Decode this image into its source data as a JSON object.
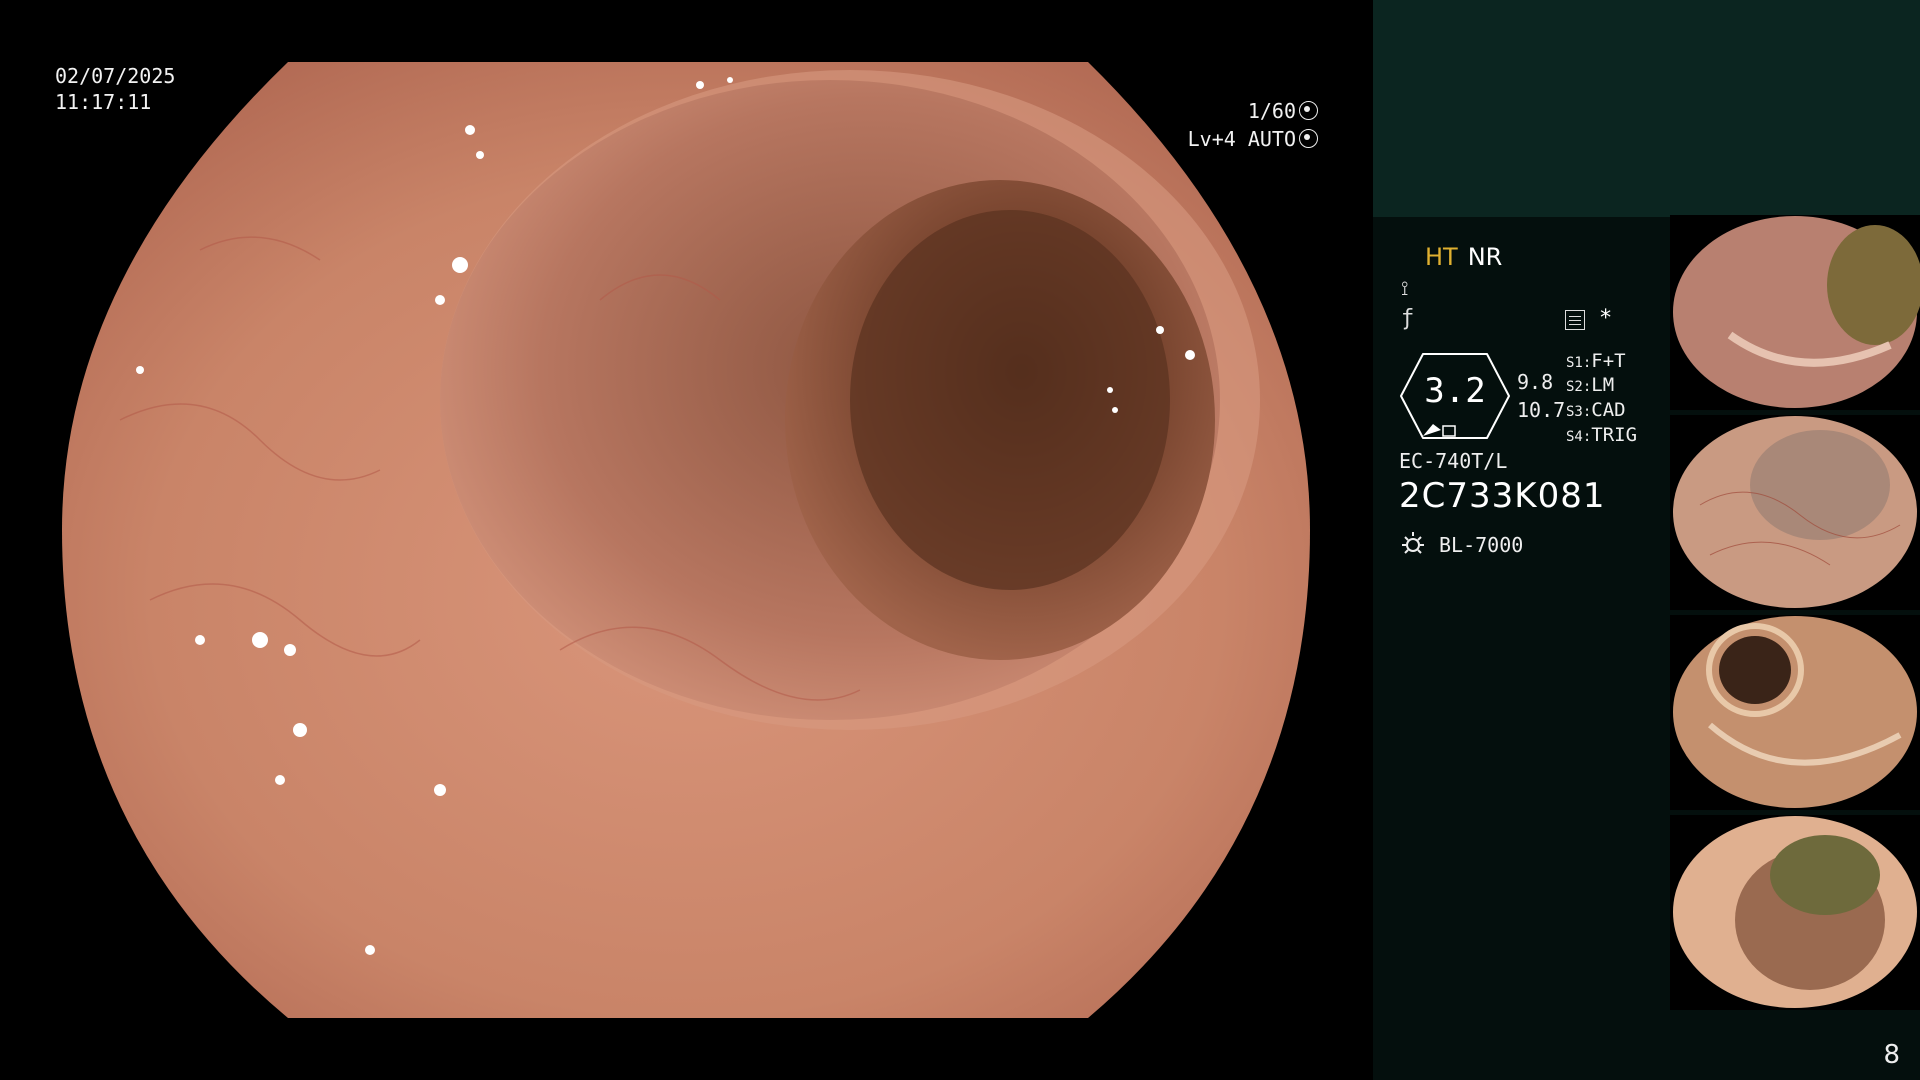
{
  "main_view": {
    "date": "02/07/2025",
    "time": "11:17:11",
    "shutter": "1/60",
    "shutter_icon": "iris-icon",
    "level": "Lv+4 AUTO",
    "level_icon": "auto-iris-icon"
  },
  "panel": {
    "mode_ht": "HT",
    "mode_nr": "NR",
    "symbol_a": "⟟",
    "symbol_b": "ƒ",
    "star": "*",
    "gauge_value": "3.2",
    "gauge_side1": "9.8",
    "gauge_side2": "10.7",
    "s_modes": [
      {
        "key": "S1:",
        "value": "F+T"
      },
      {
        "key": "S2:",
        "value": "LM"
      },
      {
        "key": "S3:",
        "value": "CAD"
      },
      {
        "key": "S4:",
        "value": "TRIG"
      }
    ],
    "model": "EC-740T/L",
    "serial": "2C733K081",
    "light_source": "BL-7000",
    "page_number": "8"
  },
  "colors": {
    "panel_bg": "#040f0d",
    "panel_top_bg": "#0b2520",
    "mode_ht": "#e0b030",
    "tissue": "#c98a70"
  }
}
